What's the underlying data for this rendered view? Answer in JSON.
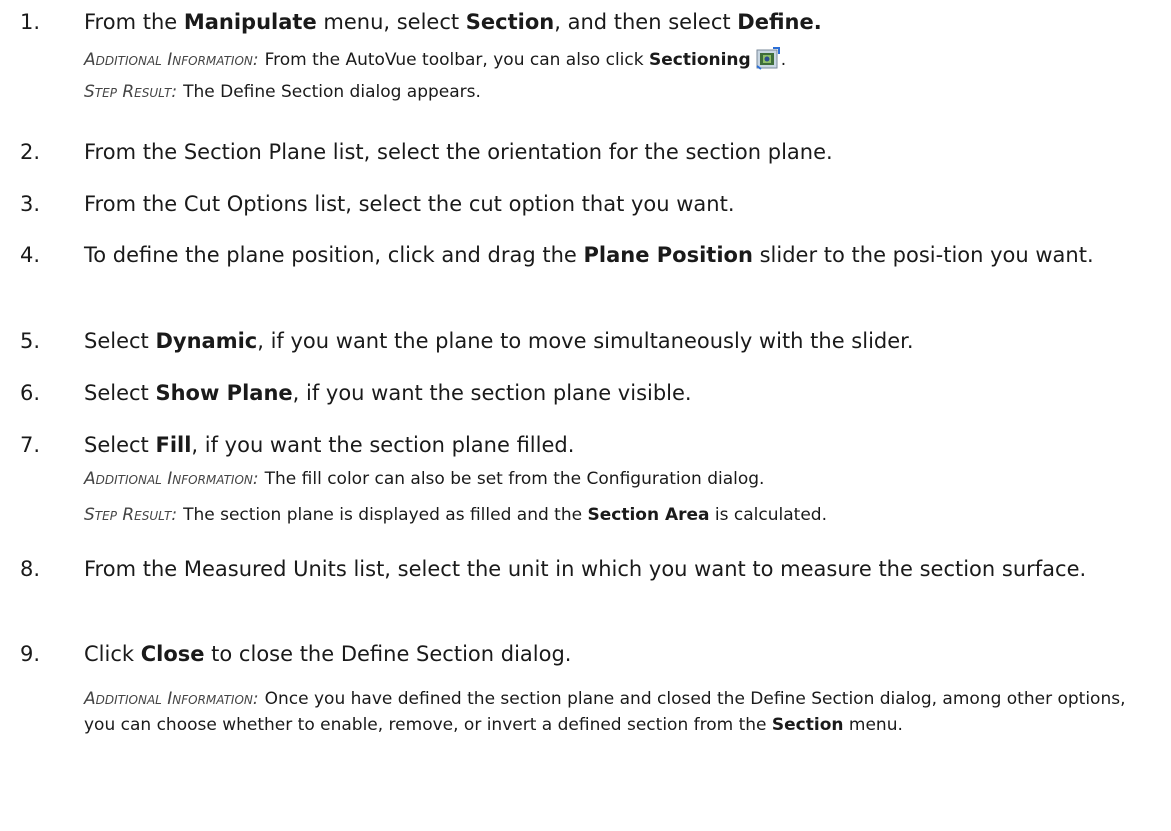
{
  "steps": [
    {
      "num": "1.",
      "pre1": "From the ",
      "b1": "Manipulate",
      "mid1": " menu, select ",
      "b2": "Section",
      "mid2": ", and then select ",
      "b3": "Define.",
      "info_label": "Additional Information:",
      "info_pre": "From the AutoVue toolbar, you can also click ",
      "info_bold": "Sectioning",
      "info_post": ".",
      "info_icon": "sectioning-icon",
      "result_label": "Step Result:",
      "result_text": "The Define Section dialog appears."
    },
    {
      "num": "2.",
      "text": "From the Section Plane list, select the orientation for the section plane."
    },
    {
      "num": "3.",
      "text": "From the Cut Options list, select the cut option that you want."
    },
    {
      "num": "4.",
      "pre": "To define the plane position, click and drag the ",
      "bold": "Plane Position",
      "post": " slider to the posi-tion you want."
    },
    {
      "num": "5.",
      "pre": "Select ",
      "bold": "Dynamic",
      "post": ", if you want the plane to move simultaneously with the slider."
    },
    {
      "num": "6.",
      "pre": "Select ",
      "bold": "Show Plane",
      "post": ", if you want the section plane visible."
    },
    {
      "num": "7.",
      "pre": "Select ",
      "bold": "Fill",
      "post": ", if you want the section plane filled.",
      "info_label": "Additional Information:",
      "info_text": "The fill color can also be set from the Configuration dialog.",
      "result_label": "Step Result:",
      "result_pre": "The section plane is displayed as filled and the ",
      "result_bold": "Section Area",
      "result_post": " is calculated."
    },
    {
      "num": "8.",
      "text": "From the Measured Units list, select the unit in which you want to measure the section surface."
    },
    {
      "num": "9.",
      "pre": "Click ",
      "bold": "Close",
      "post": " to close the Define Section dialog.",
      "info_label": "Additional Information:",
      "info_pre": "Once you have defined the section plane and closed the Define Section dialog, among other options, you can choose whether to enable, remove, or invert a defined section from the ",
      "info_bold": "Section",
      "info_post": " menu."
    }
  ]
}
